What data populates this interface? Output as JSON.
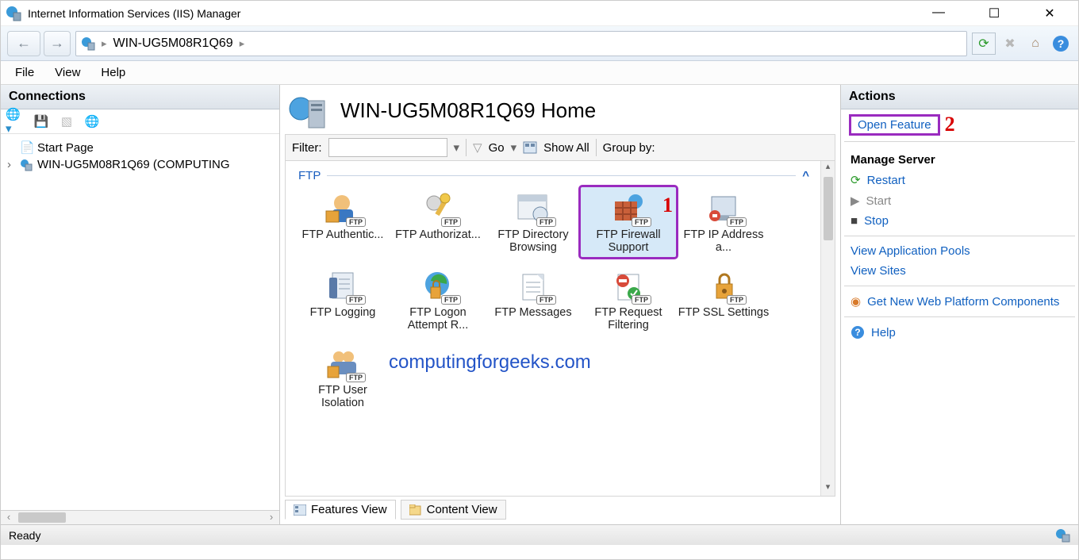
{
  "window": {
    "title": "Internet Information Services (IIS) Manager"
  },
  "breadcrumb": {
    "server": "WIN-UG5M08R1Q69"
  },
  "menu": {
    "file": "File",
    "view": "View",
    "help": "Help"
  },
  "connections": {
    "title": "Connections",
    "start_page": "Start Page",
    "server_node": "WIN-UG5M08R1Q69 (COMPUTING"
  },
  "center": {
    "title": "WIN-UG5M08R1Q69 Home",
    "filter_label": "Filter:",
    "go": "Go",
    "show_all": "Show All",
    "group_by": "Group by:",
    "group_ftp": "FTP",
    "items": [
      {
        "label": "FTP Authentic..."
      },
      {
        "label": "FTP Authorizat..."
      },
      {
        "label": "FTP Directory Browsing"
      },
      {
        "label": "FTP Firewall Support"
      },
      {
        "label": "FTP IP Address a..."
      },
      {
        "label": "FTP Logging"
      },
      {
        "label": "FTP Logon Attempt R..."
      },
      {
        "label": "FTP Messages"
      },
      {
        "label": "FTP Request Filtering"
      },
      {
        "label": "FTP SSL Settings"
      },
      {
        "label": "FTP User Isolation"
      }
    ],
    "features_view": "Features View",
    "content_view": "Content View",
    "watermark": "computingforgeeks.com",
    "annot1": "1"
  },
  "actions": {
    "title": "Actions",
    "open_feature": "Open Feature",
    "annot2": "2",
    "manage_server": "Manage Server",
    "restart": "Restart",
    "start": "Start",
    "stop": "Stop",
    "view_app_pools": "View Application Pools",
    "view_sites": "View Sites",
    "get_new_web": "Get New Web Platform Components",
    "help": "Help"
  },
  "status": {
    "ready": "Ready"
  }
}
